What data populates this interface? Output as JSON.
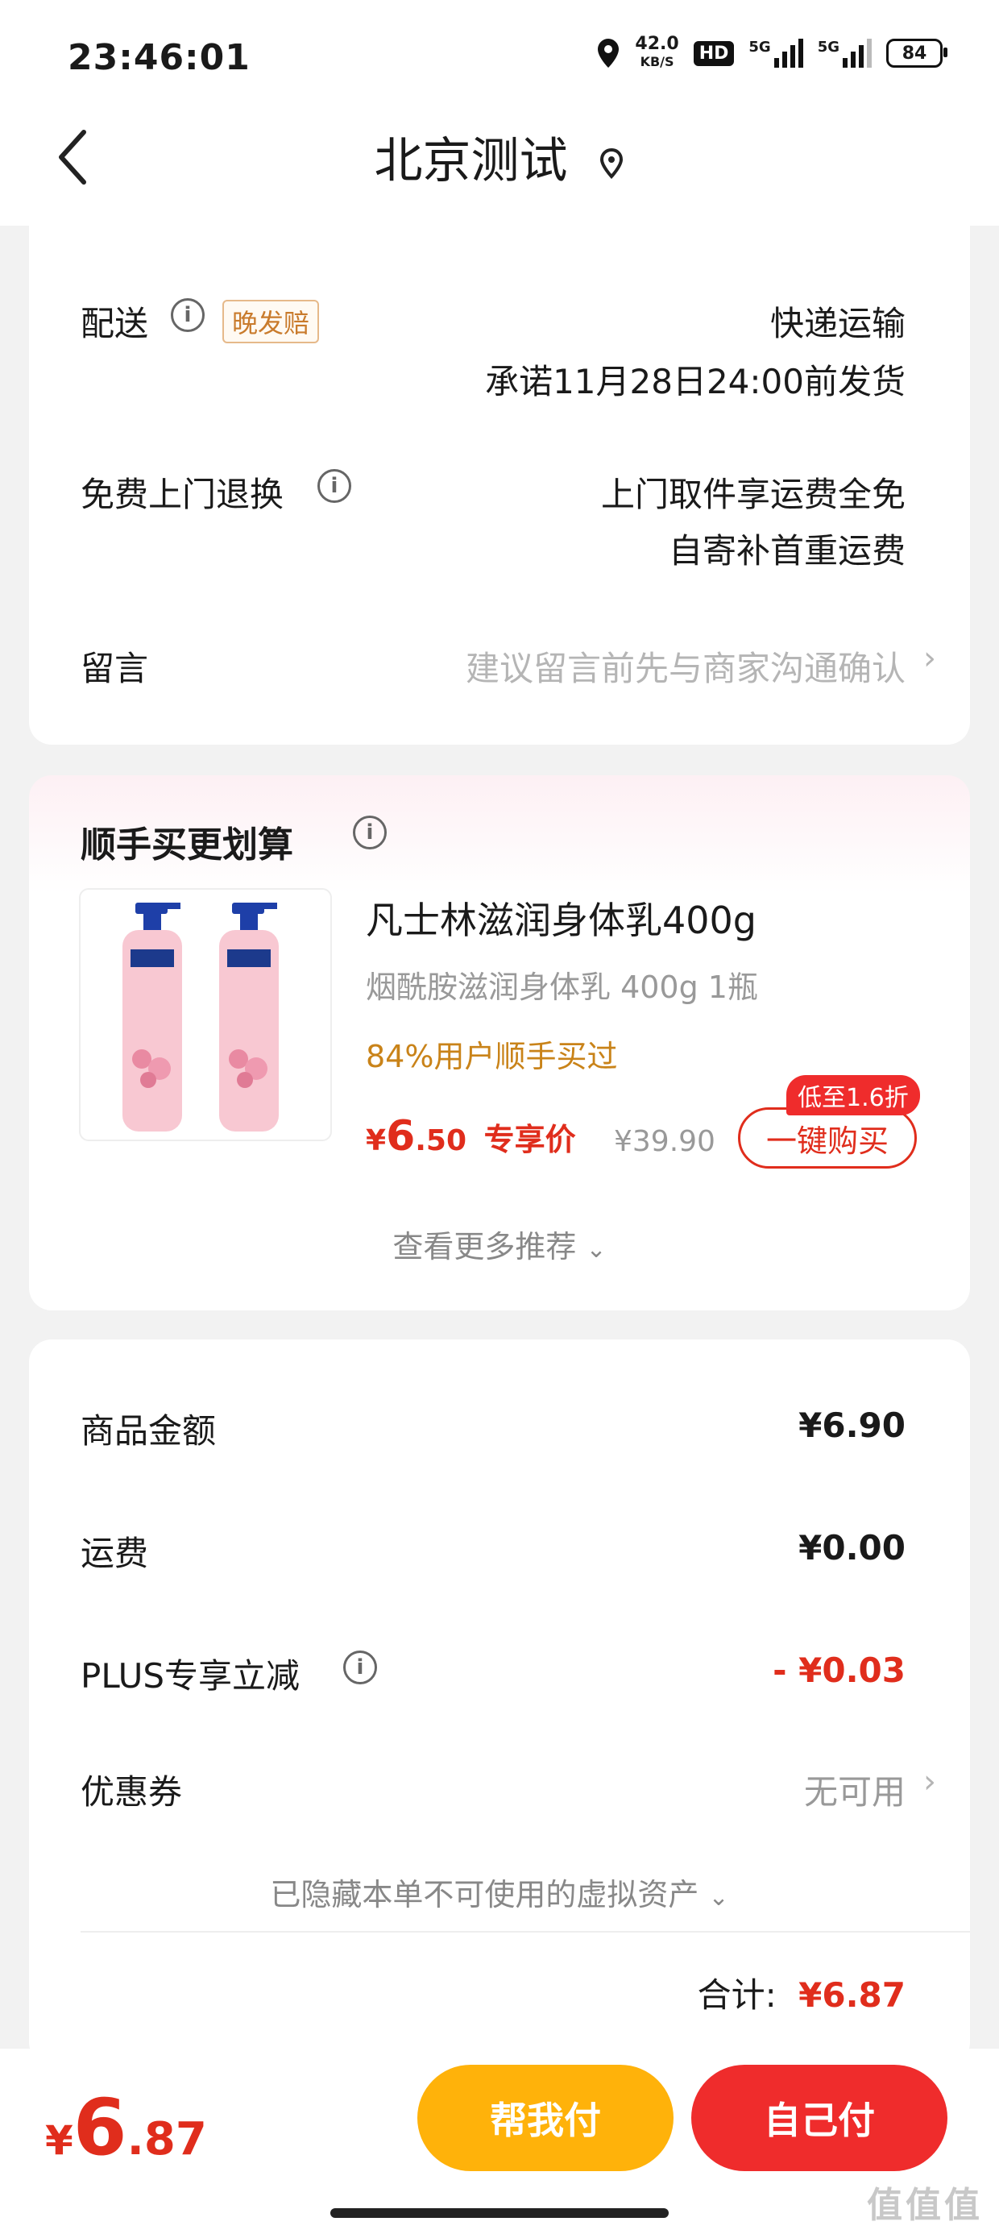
{
  "status_bar": {
    "time": "23:46:01",
    "net_speed_value": "42.0",
    "net_speed_unit": "KB/S",
    "hd_label": "HD",
    "sim1_label": "5G",
    "sim2_label": "5G",
    "battery": "84"
  },
  "header": {
    "back_icon": "chevron-left-icon",
    "title": "北京测试",
    "location_icon": "location-pin-icon"
  },
  "delivery_card": {
    "delivery_label": "配送",
    "late_badge": "晚发赔",
    "delivery_method": "快递运输",
    "delivery_promise": "承诺11月28日24:00前发货",
    "return_label": "免费上门退换",
    "return_line1": "上门取件享运费全免",
    "return_line2": "自寄补首重运费",
    "message_label": "留言",
    "message_placeholder": "建议留言前先与商家沟通确认"
  },
  "addon_card": {
    "title": "顺手买更划算",
    "product_name": "凡士林滋润身体乳400g",
    "product_spec": "烟酰胺滋润身体乳 400g 1瓶",
    "buy_rate": "84%用户顺手买过",
    "price_symbol": "¥",
    "price_int": "6",
    "price_dec": ".50",
    "exclusive_label": "专享价",
    "original_price": "¥39.90",
    "discount_tag": "低至1.6折",
    "buy_button": "一键购买",
    "more_label": "查看更多推荐"
  },
  "summary_card": {
    "goods_label": "商品金额",
    "goods_value": "¥6.90",
    "shipping_label": "运费",
    "shipping_value": "¥0.00",
    "plus_label": "PLUS专享立减",
    "plus_value": "- ¥0.03",
    "coupon_label": "优惠券",
    "coupon_value": "无可用",
    "hidden_assets": "已隐藏本单不可使用的虚拟资产",
    "total_label": "合计:",
    "total_value": "¥6.87"
  },
  "bottom_bar": {
    "price_symbol": "¥",
    "price_int": "6",
    "price_dec": ".87",
    "help_pay": "帮我付",
    "self_pay": "自己付"
  },
  "watermark": "值值值"
}
